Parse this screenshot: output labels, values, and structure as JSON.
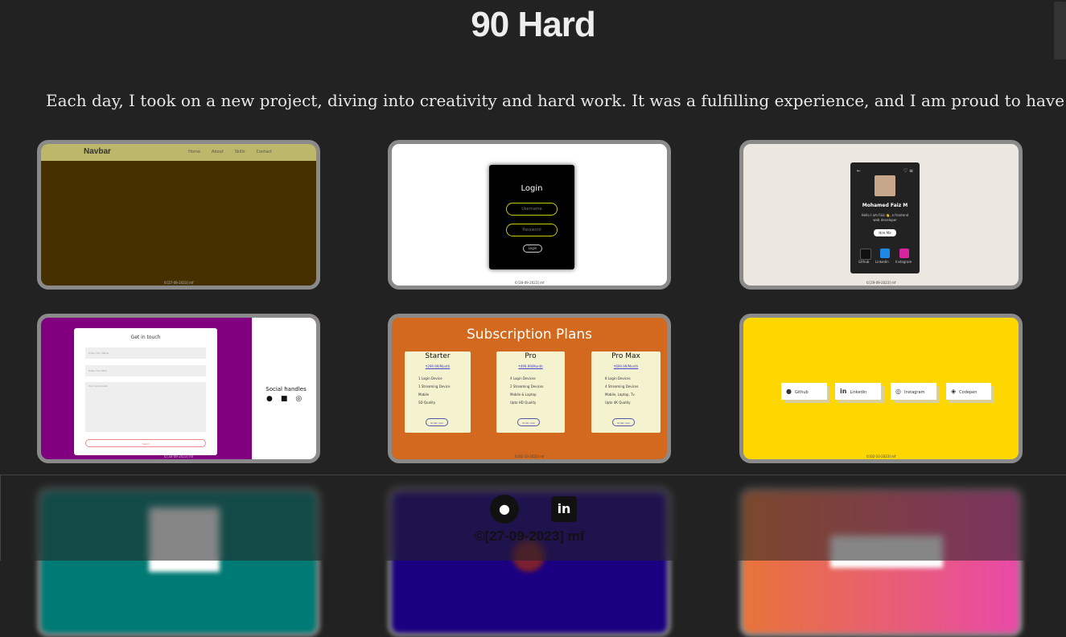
{
  "header": {
    "title": "90 Hard"
  },
  "intro": {
    "text": "Each day, I took on a new project, diving into creativity and hard work. It was a fulfilling experience, and I am proud to have"
  },
  "cards": [
    {
      "id": "navbar",
      "brand": "Navbar",
      "links": [
        "Home",
        "About",
        "Skills",
        "Contact"
      ],
      "footer": "©[27-09-2023] mf",
      "bg": "#463000"
    },
    {
      "id": "login",
      "title": "Login",
      "username_placeholder": "Username",
      "password_placeholder": "Password",
      "button": "Login",
      "footer": "©[28-09-2023] mf",
      "bg": "#ffffff"
    },
    {
      "id": "profile",
      "name": "Mohamed Faiz M",
      "bio_line1": "Hello I am Faiz 👋, a frontend",
      "bio_line2": "web developer",
      "button": "Hire Me",
      "socials": [
        "Github",
        "Linkedin",
        "Instagram"
      ],
      "footer": "©[29-09-2023] mf",
      "bg": "#ece7e0"
    },
    {
      "id": "contact",
      "title": "Get in touch",
      "name_placeholder": "Enter Your Name",
      "email_placeholder": "Enter Your Mail",
      "comments_placeholder": "Your Comments",
      "button": "Send",
      "side_title": "Social handles",
      "footer": "©[30-09-2023] mf",
      "bg": "#800080"
    },
    {
      "id": "subscription",
      "title": "Subscription Plans",
      "plans": [
        {
          "name": "Starter",
          "price": "₹299.99/",
          "period": "Month",
          "features": [
            "1 Login Device",
            "1 Streaming Device",
            "Mobile",
            "SD Quality"
          ],
          "button": "Order now"
        },
        {
          "name": "Pro",
          "price": "₹499.99/",
          "period": "Month",
          "features": [
            "4 Login Devices",
            "2 Streaming Devices",
            "Mobile & Laptop",
            "Upto HD Quality"
          ],
          "button": "Order now"
        },
        {
          "name": "Pro Max",
          "price": "₹699.99/",
          "period": "Month",
          "features": [
            "8 Login Devices",
            "4 Streaming Devices",
            "Mobile, Laptop, Tv",
            "Upto 4K Quality"
          ],
          "button": "Order now"
        }
      ],
      "footer": "©[01-10-2023] mf",
      "bg": "#d2691e"
    },
    {
      "id": "social-buttons",
      "buttons": [
        "Github",
        "Linkedin",
        "Instagram",
        "Codepen"
      ],
      "footer": "©[02-10-2023] mf",
      "bg": "#ffd700"
    }
  ],
  "footer": {
    "copyright": "©[27-09-2023] mf",
    "icons": [
      "github-icon",
      "linkedin-icon"
    ]
  }
}
